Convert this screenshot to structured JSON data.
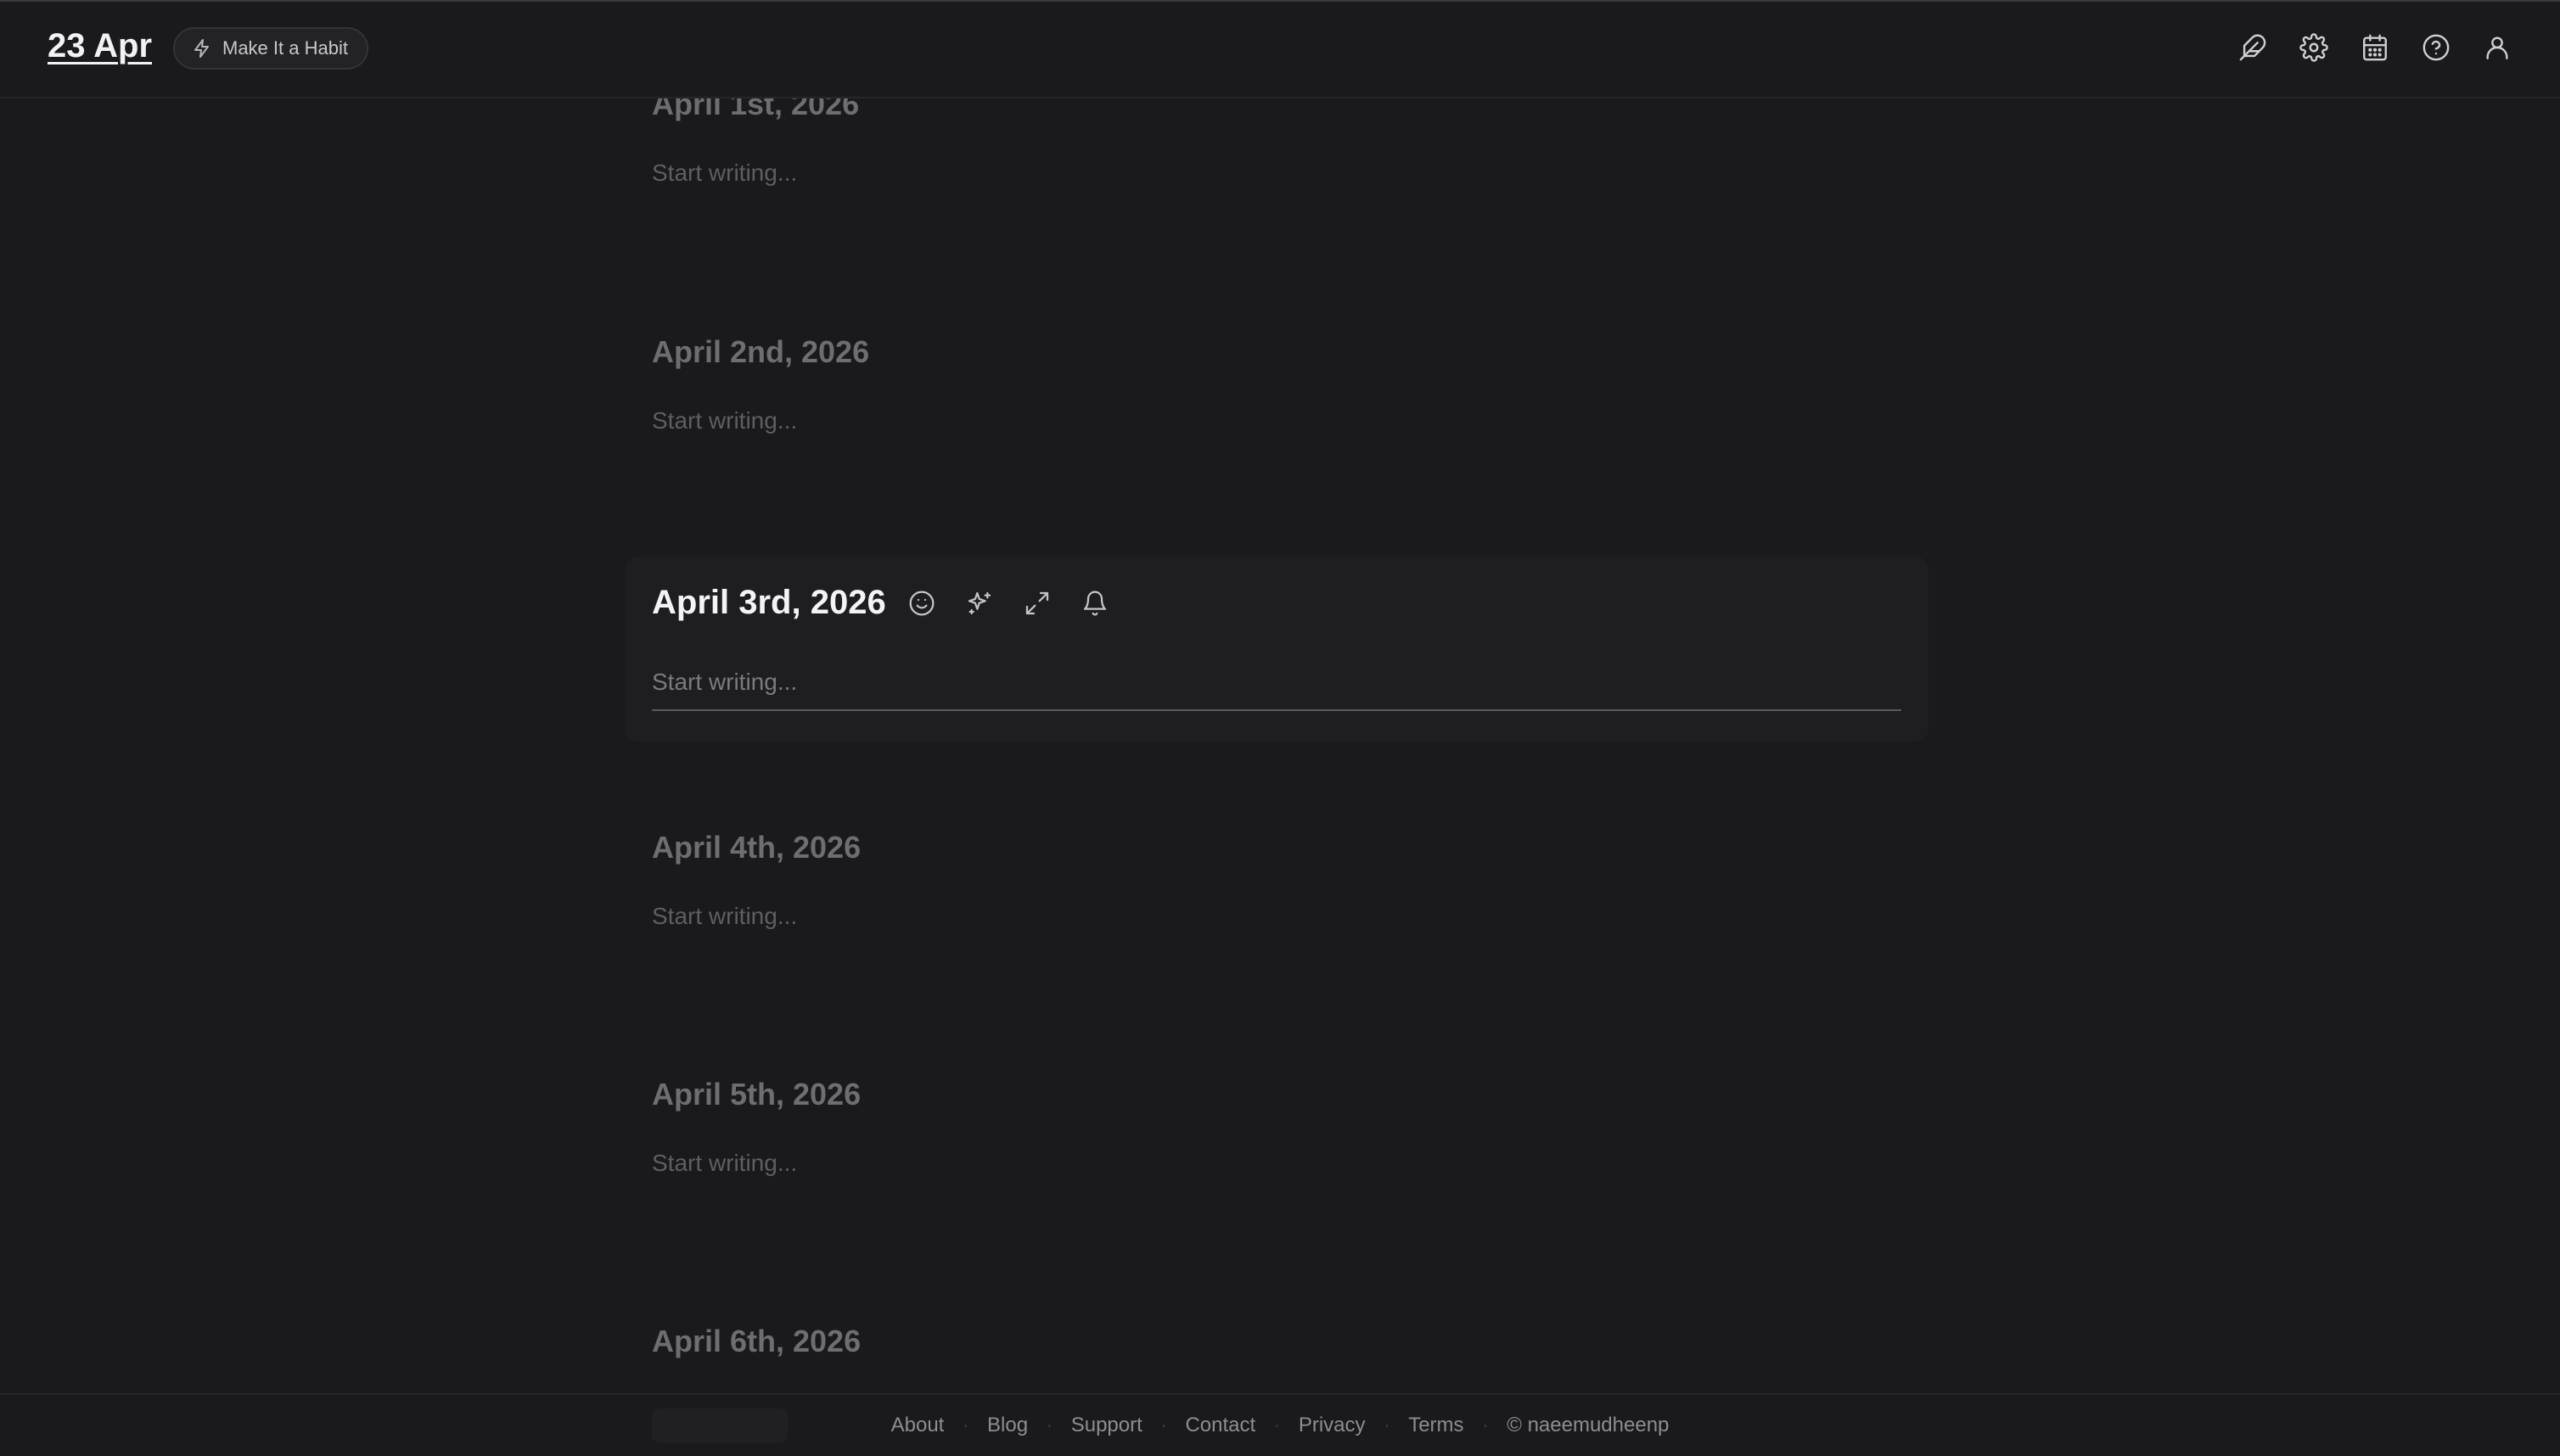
{
  "header": {
    "date_title": "23 Apr",
    "habit_button": "Make It a Habit",
    "icons": [
      "feather-icon",
      "gear-icon",
      "calendar-icon",
      "help-icon",
      "user-icon"
    ]
  },
  "entries": [
    {
      "title": "April 1st, 2026",
      "placeholder": "Start writing..."
    },
    {
      "title": "April 2nd, 2026",
      "placeholder": "Start writing..."
    },
    {
      "title": "April 3rd, 2026",
      "placeholder": "Start writing...",
      "active": true,
      "tools": [
        "mood-icon",
        "sparkles-icon",
        "expand-icon",
        "bell-icon"
      ]
    },
    {
      "title": "April 4th, 2026",
      "placeholder": "Start writing..."
    },
    {
      "title": "April 5th, 2026",
      "placeholder": "Start writing..."
    },
    {
      "title": "April 6th, 2026",
      "placeholder": ""
    }
  ],
  "footer": {
    "links": [
      "About",
      "Blog",
      "Support",
      "Contact",
      "Privacy",
      "Terms"
    ],
    "credit": "© naeemudheenp"
  },
  "colors": {
    "background": "#1a1a1c",
    "active_card": "#1e1e20",
    "title_active": "#f4f4f6",
    "title_inactive": "#6d6d72"
  }
}
